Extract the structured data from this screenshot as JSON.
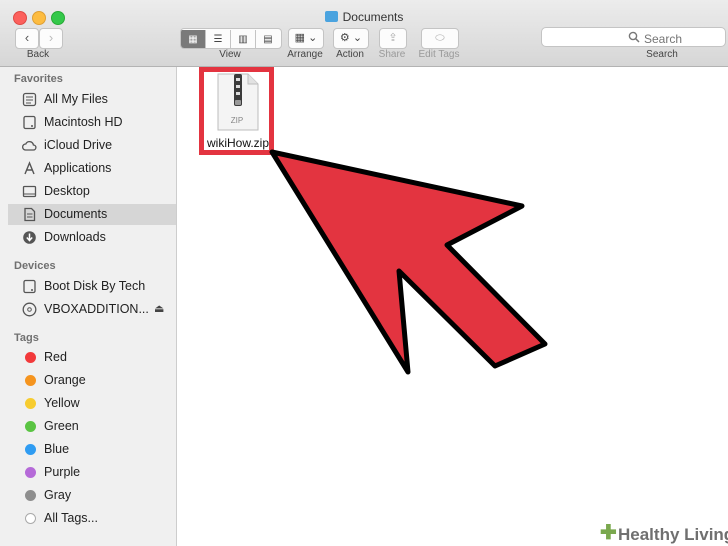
{
  "window": {
    "title": "Documents"
  },
  "toolbar": {
    "back_label": "Back",
    "view_label": "View",
    "arrange_label": "Arrange",
    "action_label": "Action",
    "share_label": "Share",
    "edit_tags_label": "Edit Tags",
    "search_placeholder": "Search",
    "search_label": "Search"
  },
  "sidebar": {
    "favorites_title": "Favorites",
    "favorites": [
      {
        "label": "All My Files",
        "icon": "all-files-icon"
      },
      {
        "label": "Macintosh HD",
        "icon": "hard-drive-icon"
      },
      {
        "label": "iCloud Drive",
        "icon": "cloud-icon"
      },
      {
        "label": "Applications",
        "icon": "applications-icon"
      },
      {
        "label": "Desktop",
        "icon": "desktop-icon"
      },
      {
        "label": "Documents",
        "icon": "documents-icon",
        "selected": true
      },
      {
        "label": "Downloads",
        "icon": "downloads-icon"
      }
    ],
    "devices_title": "Devices",
    "devices": [
      {
        "label": "Boot Disk By Tech",
        "icon": "disk-icon"
      },
      {
        "label": "VBOXADDITION...",
        "icon": "cd-icon",
        "eject": true
      }
    ],
    "tags_title": "Tags",
    "tags": [
      {
        "label": "Red",
        "color": "#f2393a"
      },
      {
        "label": "Orange",
        "color": "#f5941e"
      },
      {
        "label": "Yellow",
        "color": "#f7cc2f"
      },
      {
        "label": "Green",
        "color": "#5ac443"
      },
      {
        "label": "Blue",
        "color": "#2f9cf2"
      },
      {
        "label": "Purple",
        "color": "#b56ad8"
      },
      {
        "label": "Gray",
        "color": "#8e8e8e"
      },
      {
        "label": "All Tags...",
        "color": "#d0d0d0"
      }
    ]
  },
  "content": {
    "file": {
      "name": "wikiHow.zip",
      "type_label": "ZIP"
    }
  },
  "colors": {
    "highlight_red": "#e33440"
  },
  "watermark": {
    "text": "Healthy Living"
  }
}
